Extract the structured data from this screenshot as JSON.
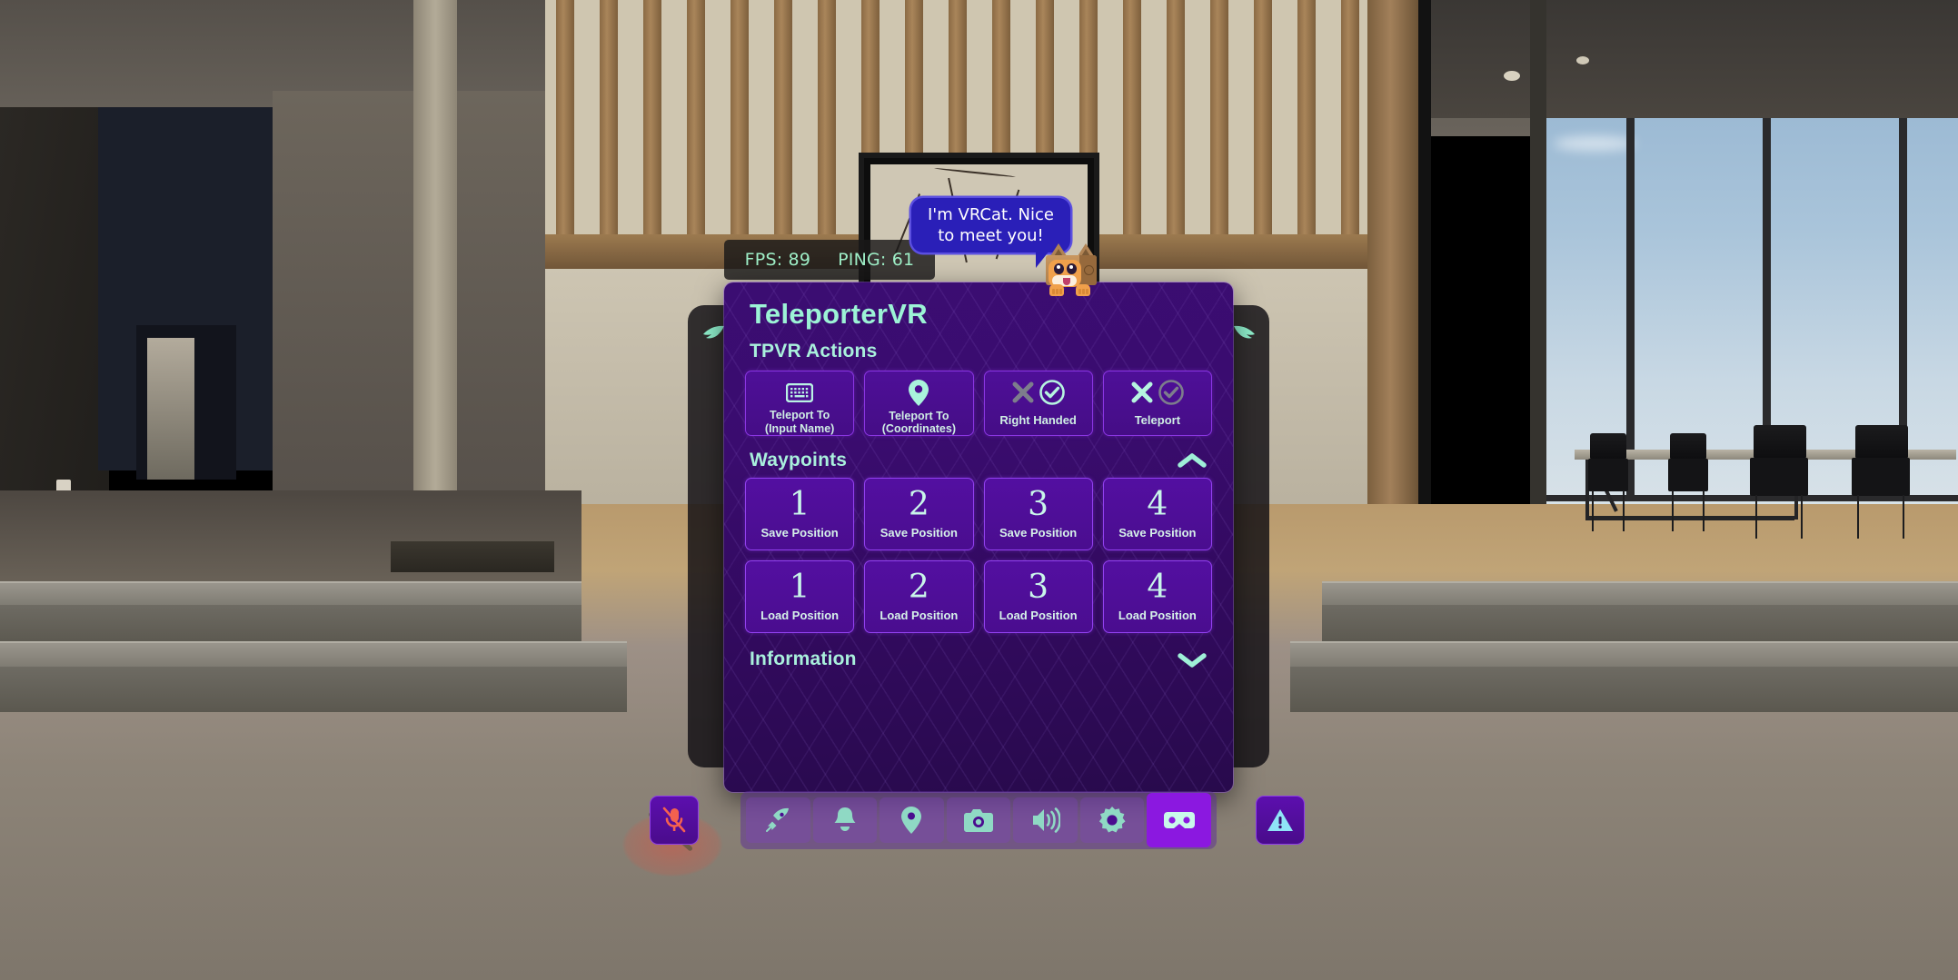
{
  "hud": {
    "fps_label": "FPS: 89",
    "ping_label": "PING: 61",
    "accent_mint": "#9ff0c8"
  },
  "speech_bubble": {
    "text": "I'm VRCat. Nice to meet you!",
    "bubble_color": "#2a1fb8"
  },
  "avatar": {
    "name": "vrcat-box-cat"
  },
  "window": {
    "title": "TeleporterVR",
    "accent": "#9cf3d6",
    "panel_color": "#3b0d72",
    "sections": [
      {
        "id": "tpvr-actions",
        "title": "TPVR Actions",
        "collapsible": false,
        "buttons": [
          {
            "icon": "keyboard-icon",
            "label": "Teleport To\n(Input Name)",
            "line1": "Teleport To",
            "line2": "(Input Name)",
            "type": "action"
          },
          {
            "icon": "location-pin-icon",
            "label": "Teleport To\n(Coordinates)",
            "line1": "Teleport To",
            "line2": "(Coordinates)",
            "type": "action"
          },
          {
            "icon": "toggle-x-check-icon",
            "label": "Right Handed",
            "type": "toggle",
            "state": "on"
          },
          {
            "icon": "toggle-x-check-icon",
            "label": "Teleport",
            "type": "toggle",
            "state": "off"
          }
        ]
      },
      {
        "id": "waypoints",
        "title": "Waypoints",
        "collapsible": true,
        "chevron": "chevron-up-icon",
        "expanded": true,
        "save_row": [
          {
            "number": "1",
            "label": "Save Position"
          },
          {
            "number": "2",
            "label": "Save Position"
          },
          {
            "number": "3",
            "label": "Save Position"
          },
          {
            "number": "4",
            "label": "Save Position"
          }
        ],
        "load_row": [
          {
            "number": "1",
            "label": "Load Position"
          },
          {
            "number": "2",
            "label": "Load Position"
          },
          {
            "number": "3",
            "label": "Load Position"
          },
          {
            "number": "4",
            "label": "Load Position"
          }
        ]
      },
      {
        "id": "information",
        "title": "Information",
        "collapsible": true,
        "chevron": "chevron-down-icon",
        "expanded": false
      }
    ]
  },
  "toolbar": {
    "mic": {
      "icon": "microphone-muted-icon",
      "state": "muted",
      "color": "#f4614f"
    },
    "items": [
      {
        "icon": "rocket-icon",
        "name": "launch"
      },
      {
        "icon": "bell-icon",
        "name": "notifications"
      },
      {
        "icon": "location-pin-icon",
        "name": "location"
      },
      {
        "icon": "camera-icon",
        "name": "camera"
      },
      {
        "icon": "speaker-icon",
        "name": "audio"
      },
      {
        "icon": "gear-icon",
        "name": "settings"
      },
      {
        "icon": "vr-headset-icon",
        "name": "vr-mode",
        "active": true
      }
    ],
    "warning": {
      "icon": "warning-triangle-icon",
      "color": "#8fe4f7"
    }
  },
  "side_tabs": [
    {
      "icon": "leaf-icon",
      "side": "left"
    },
    {
      "icon": "leaf-icon",
      "side": "right"
    }
  ]
}
